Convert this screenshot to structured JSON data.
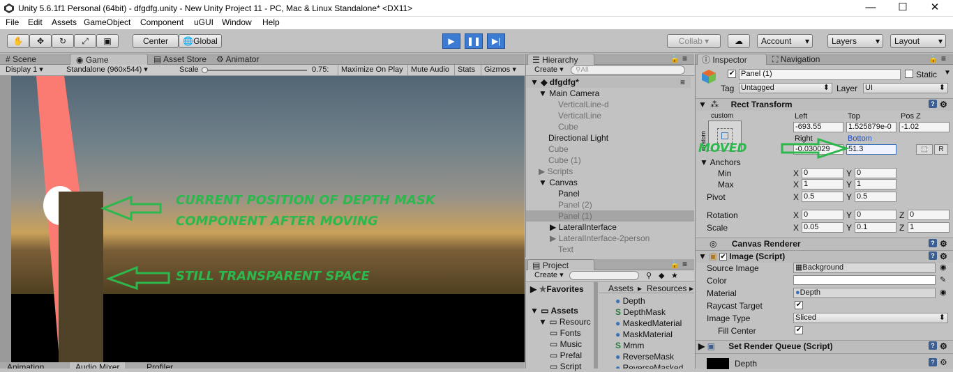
{
  "title": "Unity 5.6.1f1 Personal (64bit) - dfgdfg.unity - New Unity Project 11 - PC, Mac & Linux Standalone* <DX11>",
  "window": {
    "min": "—",
    "max": "☐",
    "close": "✕"
  },
  "menu": [
    "File",
    "Edit",
    "Assets",
    "GameObject",
    "Component",
    "uGUI",
    "Window",
    "Help"
  ],
  "toolbar": {
    "center": "Center",
    "global": "Global",
    "collab": "Collab ▾",
    "account": "Account",
    "layers": "Layers",
    "layout": "Layout"
  },
  "tabs": {
    "scene": "Scene",
    "game": "Game",
    "asset_store": "Asset Store",
    "animator": "Animator",
    "hierarchy": "Hierarchy",
    "inspector": "Inspector",
    "navigation": "Navigation",
    "project": "Project"
  },
  "game_bar": {
    "display": "Display 1",
    "resolution": "Standalone (960x544)",
    "scale_label": "Scale",
    "scale_value": "0.75:",
    "maximize": "Maximize On Play",
    "mute": "Mute Audio",
    "stats": "Stats",
    "gizmos": "Gizmos"
  },
  "annotations": {
    "current": "CURRENT POSITION OF DEPTH MASK",
    "current2": "COMPONENT AFTER MOVING",
    "transparent": "STILL TRANSPARENT SPACE",
    "moved": "MOVED"
  },
  "hierarchy": {
    "create": "Create",
    "search": "All",
    "scene": "dfgdfg*",
    "items": [
      "Main Camera",
      "VerticalLine-d",
      "VerticalLine",
      "Cube",
      "Directional Light",
      "Cube",
      "Cube (1)",
      "Scripts",
      "Canvas",
      "Panel",
      "Panel (2)",
      "Panel (1)",
      "LateralInterface",
      "LateralInterface-2person",
      "Text"
    ]
  },
  "project": {
    "create": "Create",
    "favorites": "Favorites",
    "assets": "Assets",
    "breadcrumb_assets": "Assets",
    "breadcrumb_resources": "Resources",
    "tree": [
      "Resourc",
      "Fonts",
      "Music",
      "Prefal",
      "Script"
    ],
    "files": [
      "Depth",
      "DepthMask",
      "MaskedMaterial",
      "MaskMaterial",
      "Mmm",
      "ReverseMask",
      "ReverseMasked"
    ]
  },
  "inspector": {
    "name": "Panel (1)",
    "static": "Static",
    "tag_label": "Tag",
    "tag": "Untagged",
    "layer_label": "Layer",
    "layer": "UI",
    "rect_title": "Rect Transform",
    "custom": "custom",
    "custom_v": "custom",
    "left_label": "Left",
    "top_label": "Top",
    "posz_label": "Pos Z",
    "left": "-693.55",
    "top": "1.525879e-0",
    "posz": "-1.02",
    "right_label": "Right",
    "bottom_label": "Bottom",
    "right": "-0.030029",
    "bottom": "51.3",
    "r_btn": "R",
    "anchors": "Anchors",
    "min": "Min",
    "max": "Max",
    "min_x": "0",
    "min_y": "0",
    "max_x": "1",
    "max_y": "1",
    "pivot": "Pivot",
    "pivot_x": "0.5",
    "pivot_y": "0.5",
    "rotation": "Rotation",
    "rot_x": "0",
    "rot_y": "0",
    "rot_z": "0",
    "scale": "Scale",
    "scale_x": "0.05",
    "scale_y": "0.1",
    "scale_z": "1",
    "x": "X",
    "y": "Y",
    "z": "Z",
    "canvas_renderer": "Canvas Renderer",
    "image_script": "Image (Script)",
    "source_image_label": "Source Image",
    "source_image": "Background",
    "color_label": "Color",
    "material_label": "Material",
    "material": "Depth",
    "raycast_label": "Raycast Target",
    "image_type_label": "Image Type",
    "image_type": "Sliced",
    "fill_center_label": "Fill Center",
    "render_queue": "Set Render Queue (Script)",
    "depth_preview": "Depth"
  },
  "bottom_tabs": {
    "animation": "Animation",
    "audio_mixer": "Audio Mixer",
    "profiler": "Profiler"
  }
}
